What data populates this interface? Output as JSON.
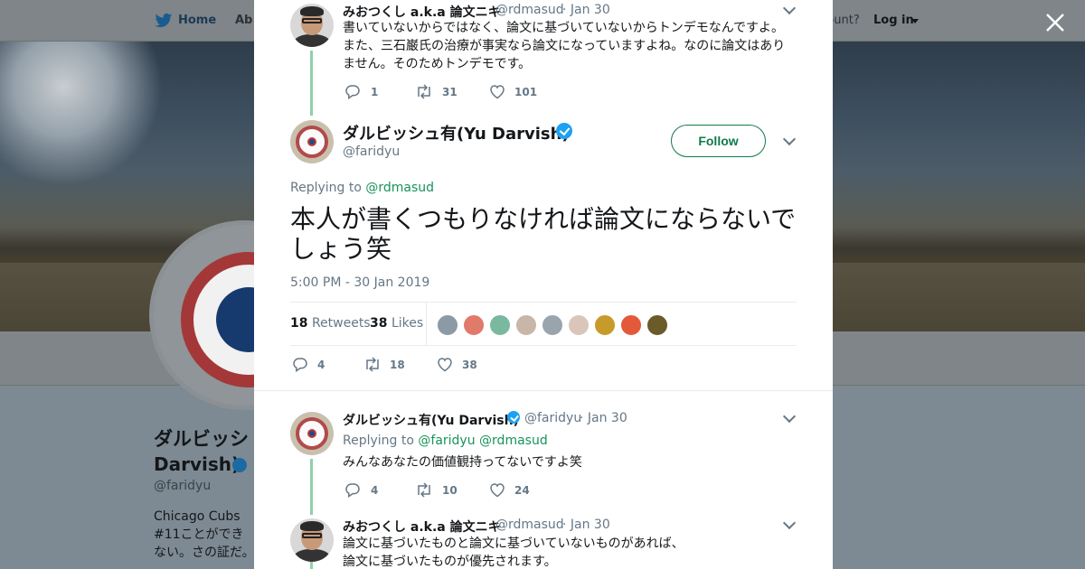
{
  "nav": {
    "home_label": "Home",
    "about_label": "Ab",
    "account_prompt": "ccount?",
    "login_label": "Log in"
  },
  "profile": {
    "name_line1": "ダルビッシ",
    "name_line2": "Darvish)",
    "handle": "@faridyu",
    "bio": "Chicago Cubs #11ことができない。さの証だ。"
  },
  "thread_top": {
    "author_name": "みおつくし a.k.a 論文ニキ",
    "author_handle": "@rdmasud",
    "date": "· Jan 30",
    "text": "書いていないからではなく、論文に基づいていないからトンデモなんですよ。また、三石巌氏の治療が事実なら論文になっていますよね。なのに論文はありません。そのためトンデモです。",
    "reply_count": "1",
    "retweet_count": "31",
    "like_count": "101"
  },
  "main_tweet": {
    "author_name": "ダルビッシュ有(Yu Darvish)",
    "author_handle": "@faridyu",
    "follow_label": "Follow",
    "replying_prefix": "Replying to",
    "replying_to": "@rdmasud",
    "text": "本人が書くつもりなければ論文にならないでしょう笑",
    "timestamp": "5:00 PM - 30 Jan 2019",
    "retweets_count": "18",
    "retweets_label": "Retweets",
    "likes_count": "38",
    "likes_label": "Likes",
    "reply_count": "4",
    "retweet_count": "18",
    "like_count": "38",
    "likers_colors": [
      "#8b9aa5",
      "#e07a6a",
      "#7ab8a0",
      "#c8b7a8",
      "#9aa4ad",
      "#d9c6b8",
      "#c79b2a",
      "#e25a3a",
      "#6b5a2a"
    ]
  },
  "reply1": {
    "author_name": "ダルビッシュ有(Yu Darvish)",
    "author_handle": "@faridyu",
    "date": "· Jan 30",
    "replying_prefix": "Replying to",
    "replying_to_1": "@faridyu",
    "replying_to_2": "@rdmasud",
    "text": "みんなあなたの価値観持ってないですよ笑",
    "reply_count": "4",
    "retweet_count": "10",
    "like_count": "24"
  },
  "reply2": {
    "author_name": "みおつくし a.k.a 論文ニキ",
    "author_handle": "@rdmasud",
    "date": "· Jan 30",
    "text_line1": "論文に基づいたものと論文に基づいていないものがあれば、",
    "text_line2": "論文に基づいたものが優先されます。"
  },
  "colors": {
    "accent_green": "#17935a",
    "link_blue": "#2b7bb9",
    "thread_line": "#8fd0a8"
  },
  "icons": {
    "close": "close-icon",
    "bird": "twitter-bird-icon",
    "reply": "reply-icon",
    "retweet": "retweet-icon",
    "like": "heart-icon",
    "verified": "verified-badge-icon",
    "more": "chevron-down-icon"
  }
}
